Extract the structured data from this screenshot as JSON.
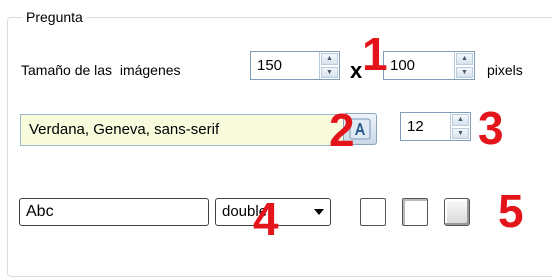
{
  "group": {
    "title": "Pregunta"
  },
  "image_size": {
    "label": "Tamaño de las  imágenes",
    "width_value": "150",
    "separator": "x",
    "height_value": "100",
    "unit_label": "pixels"
  },
  "font": {
    "family_value": "Verdana, Geneva, sans-serif",
    "size_value": "12"
  },
  "style": {
    "text_value": "Abc",
    "border_style_value": "double"
  },
  "callouts": [
    "1",
    "2",
    "3",
    "4",
    "5"
  ],
  "colors": {
    "callout": "#e4141b",
    "font_field_bg": "#f8fbdc",
    "group_border": "#d5dfe5"
  }
}
